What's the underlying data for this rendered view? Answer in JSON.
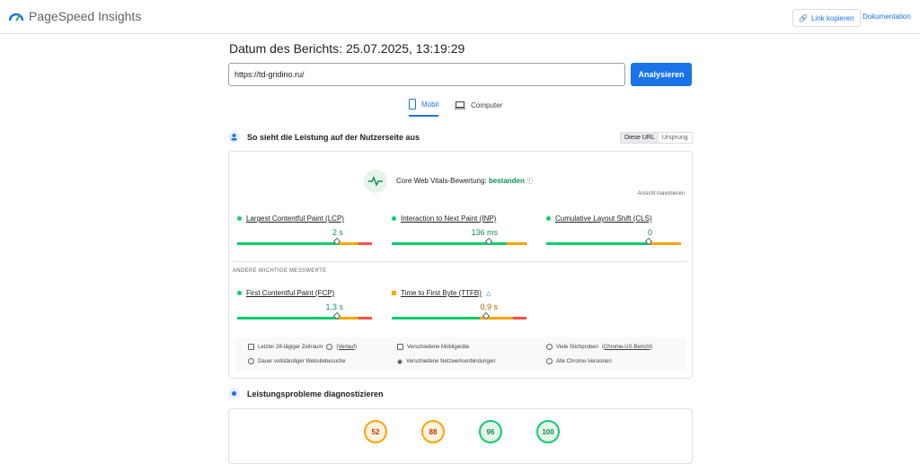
{
  "app": {
    "title": "PageSpeed Insights"
  },
  "header": {
    "copy_link": "Link kopieren",
    "docs": "Dokumentation"
  },
  "report": {
    "date": "Datum des Berichts: 25.07.2025, 13:19:29"
  },
  "search": {
    "url": "https://td-gridino.ru/",
    "analyze": "Analysieren"
  },
  "tabs": [
    {
      "label": "Mobil",
      "active": true
    },
    {
      "label": "Computer",
      "active": false
    }
  ],
  "field_section": {
    "title": "So sieht die Leistung auf der Nutzerseite aus",
    "toggle": [
      "Diese URL",
      "Ursprung"
    ],
    "cwv_label": "Core Web Vitals-Bewertung:",
    "cwv_status": "bestanden",
    "expand": "Ansicht maximieren",
    "other_label": "ANDERE WICHTIGE MESSWERTE",
    "metrics": [
      {
        "name": "Largest Contentful Paint (LCP)",
        "value": "2 s",
        "status": "good",
        "position": 0.72
      },
      {
        "name": "Interaction to Next Paint (INP)",
        "value": "136 ms",
        "status": "good",
        "position": 0.7
      },
      {
        "name": "Cumulative Layout Shift (CLS)",
        "value": "0",
        "status": "good",
        "position": 0.74
      },
      {
        "name": "First Contentful Paint (FCP)",
        "value": "1,3 s",
        "status": "good",
        "position": 0.72
      },
      {
        "name": "Time to First Byte (TTFB)",
        "value": "0,9 s",
        "status": "average",
        "position": 0.68
      }
    ],
    "info": [
      "Letzter 28-tägiger Zeitraum",
      "(Verlauf)",
      "Verschiedene Mobilgeräte",
      "Viele Stichproben",
      "(Chrome-UX-Bericht)",
      "Dauer vollständiger Websitebesuche",
      "Verschiedene Netzwerkverbindungen",
      "Alle Chrome-Versionen"
    ]
  },
  "diag_section": {
    "title": "Leistungsprobleme diagnostizieren",
    "scores": [
      {
        "value": "52",
        "status": "average"
      },
      {
        "value": "88",
        "status": "average"
      },
      {
        "value": "96",
        "status": "good"
      },
      {
        "value": "100",
        "status": "good"
      }
    ]
  },
  "colors": {
    "accent": "#1a73e8",
    "good": "#0cce6b",
    "average": "#ffa400",
    "poor": "#ff4e42"
  }
}
